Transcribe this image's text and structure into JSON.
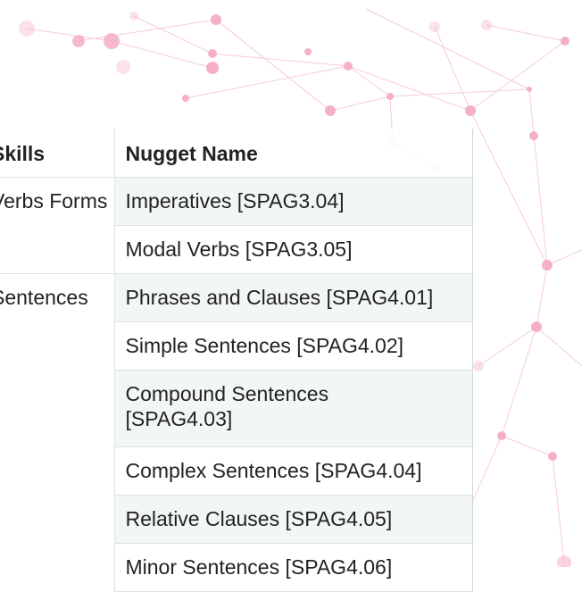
{
  "table": {
    "headers": {
      "skills": "Skills",
      "nugget": "Nugget Name"
    },
    "groups": [
      {
        "skill": "Verbs Forms",
        "nuggets": [
          "Imperatives [SPAG3.04]",
          "Modal Verbs [SPAG3.05]"
        ]
      },
      {
        "skill": "Sentences",
        "nuggets": [
          "Phrases and Clauses [SPAG4.01]",
          "Simple Sentences [SPAG4.02]",
          "Compound Sentences [SPAG4.03]",
          "Complex Sentences [SPAG4.04]",
          "Relative Clauses [SPAG4.05]",
          "Minor Sentences [SPAG4.06]"
        ]
      }
    ]
  },
  "colors": {
    "row_shade": "#f3f6f6",
    "network_pink": "#f4a9c0"
  }
}
